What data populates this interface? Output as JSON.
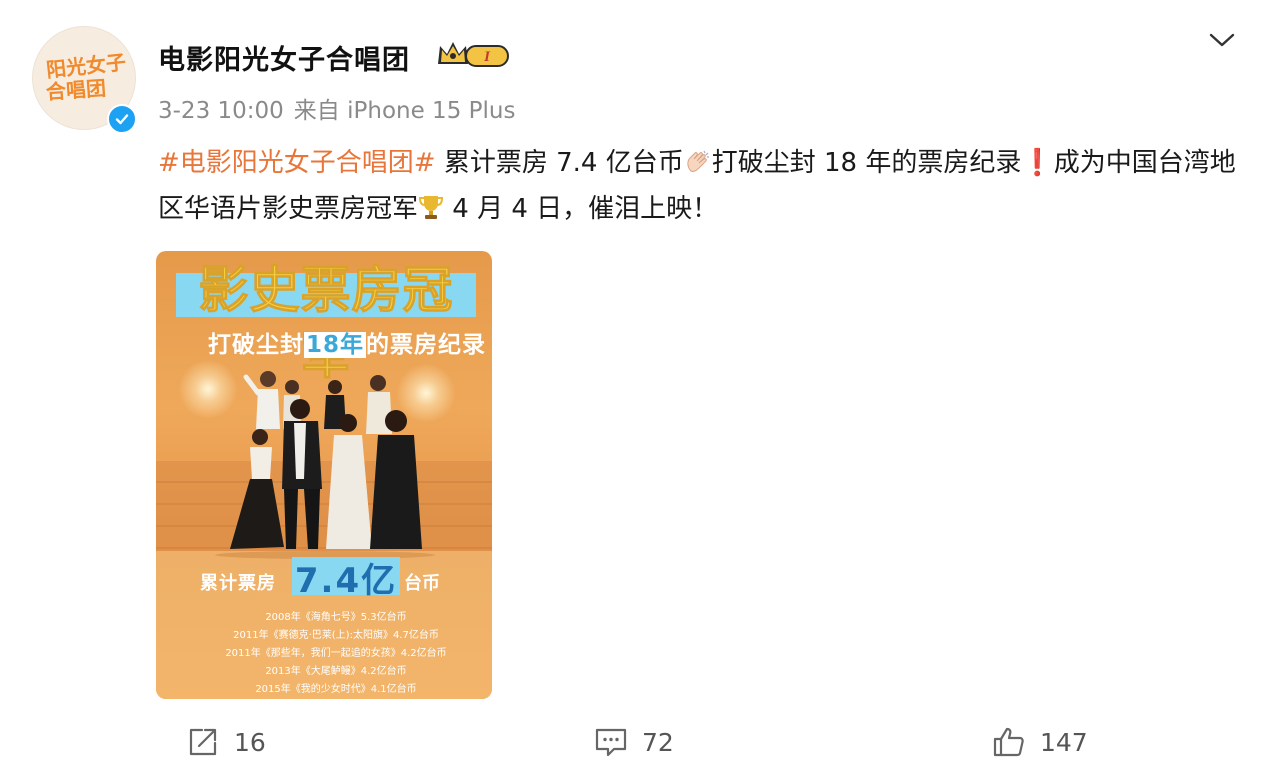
{
  "author": {
    "avatar_line1": "阳光女子",
    "avatar_line2": "合唱团",
    "name": "电影阳光女子合唱团",
    "badge_level": "I",
    "verified": true
  },
  "meta": {
    "time": "3-23 10:00",
    "source": "来自 iPhone 15 Plus"
  },
  "post": {
    "hashtag": "#电影阳光女子合唱团#",
    "text_1": " 累计票房 7.4 亿台币",
    "text_2": "打破尘封 18 年的票房纪录",
    "text_3": "成为中国台湾地区华语片影史票房冠军",
    "text_4": " 4 月 4 日，催泪上映！",
    "emoji_1": "clapping-hands-icon",
    "emoji_2": "exclamation-mark-icon",
    "emoji_3": "trophy-icon"
  },
  "poster": {
    "headline": "影史票房冠军",
    "subtitle_pre": "打破尘封",
    "subtitle_year": "18年",
    "subtitle_post": "的票房纪录",
    "boxoffice_label": "累计票房",
    "boxoffice_value": "7.4亿",
    "boxoffice_unit": "台币",
    "records": [
      "2008年《海角七号》5.3亿台币",
      "2011年《赛德克·巴莱(上):太阳旗》4.7亿台币",
      "2011年《那些年，我们一起追的女孩》4.2亿台币",
      "2013年《大尾鲈鳗》4.2亿台币",
      "2015年《我的少女时代》4.1亿台币"
    ]
  },
  "actions": {
    "shares": "16",
    "comments": "72",
    "likes": "147"
  },
  "colors": {
    "hashtag": "#e8753a",
    "verified": "#1da1f2",
    "meta_gray": "#8a8a8a",
    "poster_orange": "#e99a4e",
    "poster_blue": "#89d8f2"
  }
}
